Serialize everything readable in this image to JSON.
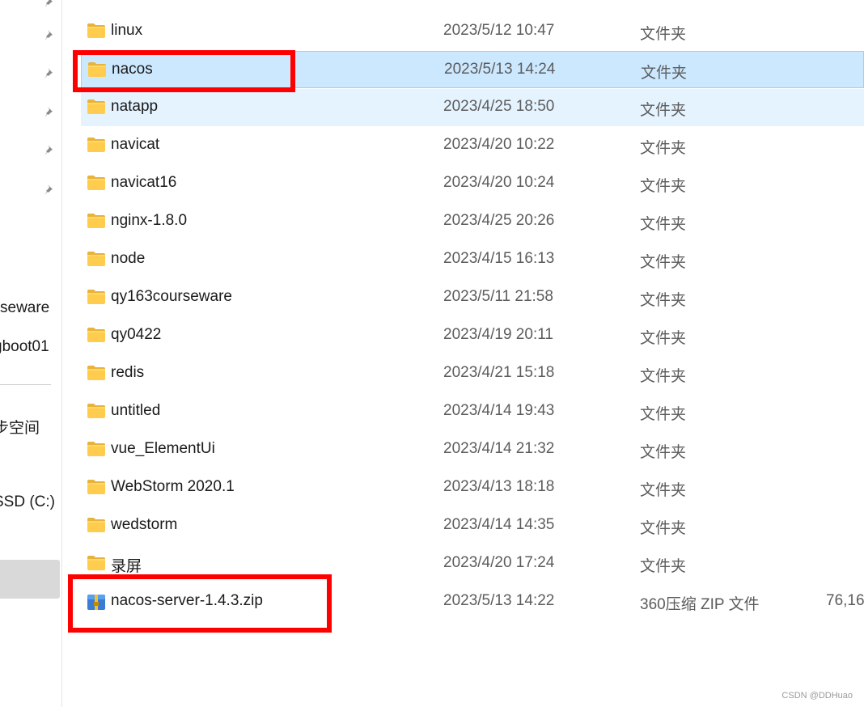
{
  "sidebar": {
    "items": [
      {
        "label": "seware"
      },
      {
        "label": "gboot01"
      },
      {
        "label": "步空间"
      },
      {
        "label": "SSD (C:)"
      }
    ]
  },
  "files": [
    {
      "name": "linux",
      "date": "2023/5/12 10:47",
      "type": "文件夹",
      "size": "",
      "icon": "folder-icon"
    },
    {
      "name": "nacos",
      "date": "2023/5/13 14:24",
      "type": "文件夹",
      "size": "",
      "icon": "folder-icon"
    },
    {
      "name": "natapp",
      "date": "2023/4/25 18:50",
      "type": "文件夹",
      "size": "",
      "icon": "folder-icon"
    },
    {
      "name": "navicat",
      "date": "2023/4/20 10:22",
      "type": "文件夹",
      "size": "",
      "icon": "folder-icon"
    },
    {
      "name": "navicat16",
      "date": "2023/4/20 10:24",
      "type": "文件夹",
      "size": "",
      "icon": "folder-icon"
    },
    {
      "name": "nginx-1.8.0",
      "date": "2023/4/25 20:26",
      "type": "文件夹",
      "size": "",
      "icon": "folder-icon"
    },
    {
      "name": "node",
      "date": "2023/4/15 16:13",
      "type": "文件夹",
      "size": "",
      "icon": "folder-icon"
    },
    {
      "name": "qy163courseware",
      "date": "2023/5/11 21:58",
      "type": "文件夹",
      "size": "",
      "icon": "folder-icon"
    },
    {
      "name": "qy0422",
      "date": "2023/4/19 20:11",
      "type": "文件夹",
      "size": "",
      "icon": "folder-icon"
    },
    {
      "name": "redis",
      "date": "2023/4/21 15:18",
      "type": "文件夹",
      "size": "",
      "icon": "folder-icon"
    },
    {
      "name": "untitled",
      "date": "2023/4/14 19:43",
      "type": "文件夹",
      "size": "",
      "icon": "folder-icon"
    },
    {
      "name": "vue_ElementUi",
      "date": "2023/4/14 21:32",
      "type": "文件夹",
      "size": "",
      "icon": "folder-icon"
    },
    {
      "name": "WebStorm 2020.1",
      "date": "2023/4/13 18:18",
      "type": "文件夹",
      "size": "",
      "icon": "folder-icon"
    },
    {
      "name": "wedstorm",
      "date": "2023/4/14 14:35",
      "type": "文件夹",
      "size": "",
      "icon": "folder-icon"
    },
    {
      "name": "录屏",
      "date": "2023/4/20 17:24",
      "type": "文件夹",
      "size": "",
      "icon": "folder-icon"
    },
    {
      "name": "nacos-server-1.4.3.zip",
      "date": "2023/5/13 14:22",
      "type": "360压缩 ZIP 文件",
      "size": "76,16",
      "icon": "zip-archive-icon"
    }
  ],
  "selected_file": "nacos",
  "hovered_file": "natapp",
  "annotation_color": "#ff0000",
  "watermark": "CSDN @DDHuao"
}
